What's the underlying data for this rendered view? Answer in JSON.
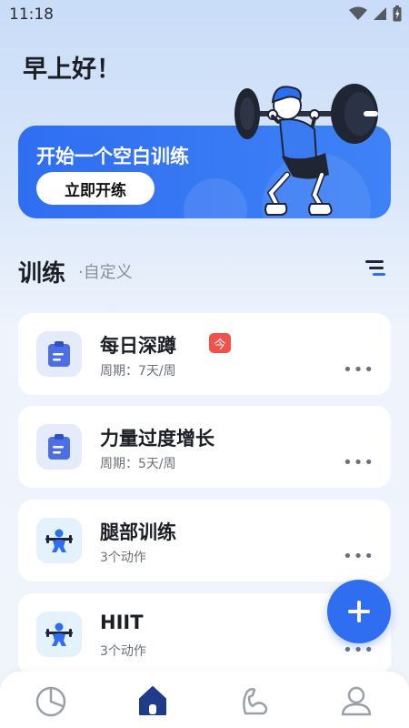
{
  "status_bar": {
    "time": "11:18"
  },
  "greeting": "早上好！",
  "banner": {
    "title": "开始一个空白训练",
    "button_label": "立即开练"
  },
  "section": {
    "title": "训练",
    "subtitle": "·自定义"
  },
  "workouts": [
    {
      "name": "每日深蹲",
      "meta": "周期：7天/周",
      "icon": "clipboard-plan-icon",
      "badge": "今"
    },
    {
      "name": "力量过度增长",
      "meta": "周期：5天/周",
      "icon": "clipboard-plan-icon"
    },
    {
      "name": "腿部训练",
      "meta": "3个动作",
      "icon": "weightlifter-icon"
    },
    {
      "name": "HIIT",
      "meta": "3个动作",
      "icon": "weightlifter-icon"
    }
  ],
  "more_label": "•••",
  "fab_label": "+",
  "colors": {
    "accent": "#2f6ef1",
    "badge": "#f0524b",
    "nav_active": "#1f3b8a",
    "nav_inactive": "#9aa0aa"
  }
}
